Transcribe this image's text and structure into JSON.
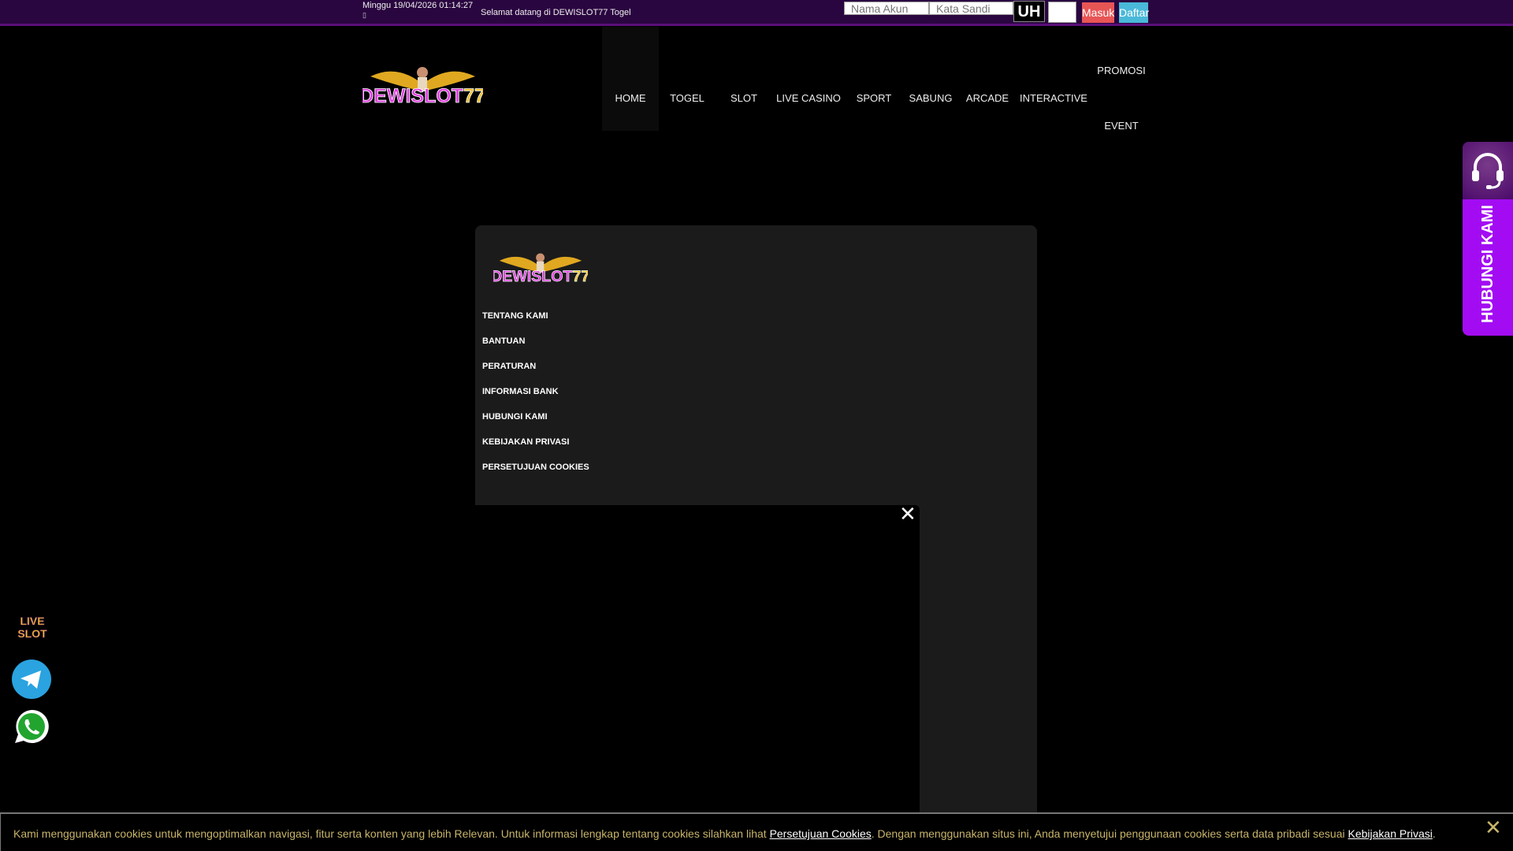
{
  "topbar": {
    "datetime": "Minggu 19/04/2026 01:14:27",
    "date_icon": "▯",
    "welcome": "Selamat datang di DEWISLOT77 Togel",
    "username_placeholder": "Nama Akun",
    "password_placeholder": "Kata Sandi",
    "captcha": "UH",
    "login": "Masuk",
    "register": "Daftar"
  },
  "logo": "DEWISLOT77",
  "nav": [
    "HOME",
    "TOGEL",
    "SLOT",
    "LIVE CASINO",
    "SPORT",
    "SABUNG",
    "ARCADE",
    "INTERACTIVE",
    "PROMOSI",
    "EVENT"
  ],
  "modal": {
    "links": [
      "TENTANG KAMI",
      "BANTUAN",
      "PERATURAN",
      "INFORMASI BANK",
      "HUBUNGI KAMI",
      "KEBIJAKAN PRIVASI",
      "PERSETUJUAN COOKIES"
    ],
    "close": "✕"
  },
  "help": {
    "label": "HUBUNGI KAMI"
  },
  "float": {
    "live_slot": "LIVE SLOT"
  },
  "cookie": {
    "text1": "Kami menggunakan cookies untuk mengoptimalkan navigasi, fitur serta konten yang lebih Relevan. Untuk informasi lengkap tentang cookies silahkan lihat ",
    "link1": "Persetujuan Cookies",
    "text2": ". Dengan menggunakan situs ini, Anda menyetujui penggunaan cookies serta data pribadi sesuai ",
    "link2": "Kebijakan Privasi",
    "text3": ".",
    "close": "✕"
  },
  "colors": {
    "topbar": "#2a0640",
    "accent": "#a30cf2",
    "login": "#e85555",
    "register": "#4ab8d8",
    "cookie_text": "#c8b46a"
  }
}
